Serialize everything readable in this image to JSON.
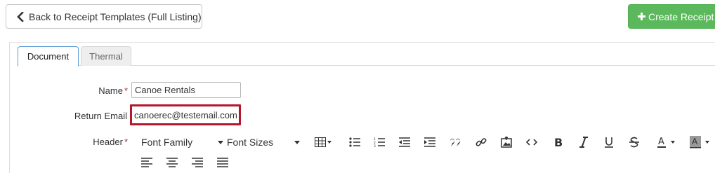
{
  "top_bar": {
    "back_label": "Back to Receipt Templates (Full Listing)",
    "create_label": "Create Receipt",
    "create_color": "#5cb85c"
  },
  "tabs": [
    {
      "label": "Document",
      "active": true
    },
    {
      "label": "Thermal",
      "active": false
    }
  ],
  "form": {
    "name_label": "Name",
    "name_value": "Canoe Rentals",
    "email_label": "Return Email",
    "email_value": "canoerec@testemail.com",
    "header_label": "Header",
    "required_marker": "*",
    "highlight_color": "#b5162a"
  },
  "editor_toolbar": {
    "font_family_label": "Font Family",
    "font_sizes_label": "Font Sizes",
    "buttons": [
      "table-icon",
      "bulleted-list-icon",
      "numbered-list-icon",
      "outdent-icon",
      "indent-icon",
      "blockquote-icon",
      "link-icon",
      "image-icon",
      "code-icon",
      "bold-icon",
      "italic-icon",
      "underline-icon",
      "strikethrough-icon",
      "text-color-icon",
      "background-color-icon",
      "align-left-icon",
      "align-center-icon",
      "align-right-icon",
      "align-justify-icon"
    ]
  }
}
